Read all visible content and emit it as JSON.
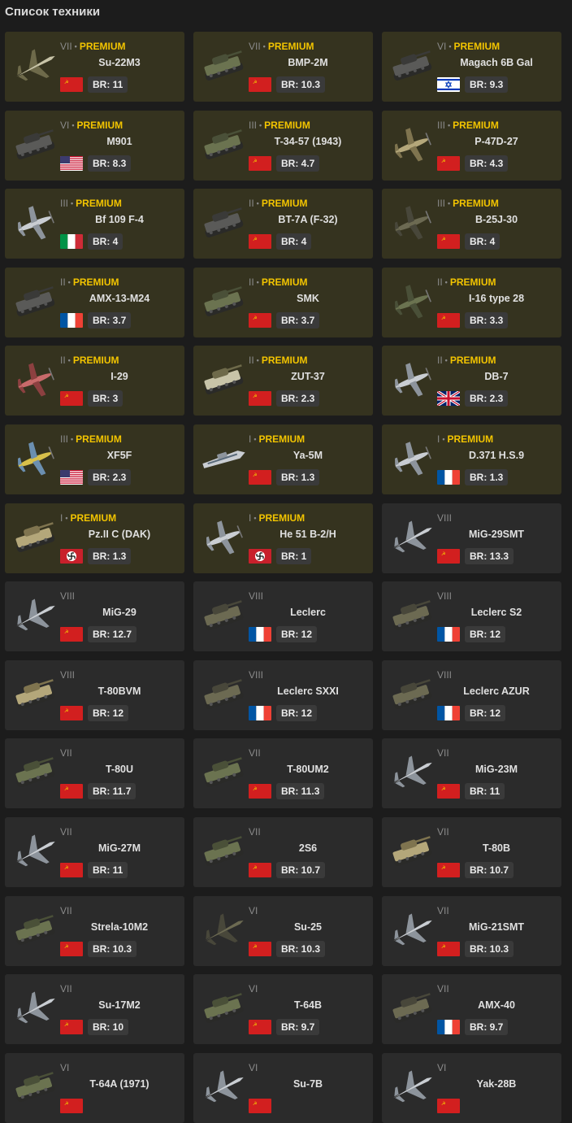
{
  "title": "Список техники",
  "premium_label": "PREMIUM",
  "br_prefix": "BR: ",
  "vehicles": [
    {
      "rank": "VII",
      "premium": true,
      "name": "Su-22M3",
      "nation": "ussr",
      "br": "11",
      "type": "jet",
      "tint": "camo"
    },
    {
      "rank": "VII",
      "premium": true,
      "name": "BMP-2M",
      "nation": "ussr",
      "br": "10.3",
      "type": "tank",
      "tint": "green"
    },
    {
      "rank": "VI",
      "premium": true,
      "name": "Magach 6B Gal",
      "nation": "israel",
      "br": "9.3",
      "type": "tank",
      "tint": "dark"
    },
    {
      "rank": "VI",
      "premium": true,
      "name": "M901",
      "nation": "usa",
      "br": "8.3",
      "type": "tank",
      "tint": "dark"
    },
    {
      "rank": "III",
      "premium": true,
      "name": "T-34-57 (1943)",
      "nation": "ussr",
      "br": "4.7",
      "type": "tank",
      "tint": "green"
    },
    {
      "rank": "III",
      "premium": true,
      "name": "P-47D-27",
      "nation": "ussr",
      "br": "4.3",
      "type": "prop",
      "tint": "tan"
    },
    {
      "rank": "III",
      "premium": true,
      "name": "Bf 109 F-4",
      "nation": "italy",
      "br": "4",
      "type": "prop",
      "tint": "light"
    },
    {
      "rank": "II",
      "premium": true,
      "name": "BT-7A (F-32)",
      "nation": "ussr",
      "br": "4",
      "type": "tank",
      "tint": "dark"
    },
    {
      "rank": "III",
      "premium": true,
      "name": "B-25J-30",
      "nation": "ussr",
      "br": "4",
      "type": "prop",
      "tint": "olive"
    },
    {
      "rank": "II",
      "premium": true,
      "name": "AMX-13-M24",
      "nation": "france",
      "br": "3.7",
      "type": "tank",
      "tint": "dark"
    },
    {
      "rank": "II",
      "premium": true,
      "name": "SMK",
      "nation": "ussr",
      "br": "3.7",
      "type": "tank",
      "tint": "green"
    },
    {
      "rank": "II",
      "premium": true,
      "name": "I-16 type 28",
      "nation": "ussr",
      "br": "3.3",
      "type": "prop",
      "tint": "green"
    },
    {
      "rank": "II",
      "premium": true,
      "name": "I-29",
      "nation": "ussr",
      "br": "3",
      "type": "prop",
      "tint": "red"
    },
    {
      "rank": "II",
      "premium": true,
      "name": "ZUT-37",
      "nation": "ussr",
      "br": "2.3",
      "type": "tank",
      "tint": "camo"
    },
    {
      "rank": "II",
      "premium": true,
      "name": "DB-7",
      "nation": "uk",
      "br": "2.3",
      "type": "prop",
      "tint": "light"
    },
    {
      "rank": "III",
      "premium": true,
      "name": "XF5F",
      "nation": "usa",
      "br": "2.3",
      "type": "prop",
      "tint": "yellow"
    },
    {
      "rank": "I",
      "premium": true,
      "name": "Ya-5M",
      "nation": "ussr",
      "br": "1.3",
      "type": "boat",
      "tint": "light"
    },
    {
      "rank": "I",
      "premium": true,
      "name": "D.371 H.S.9",
      "nation": "france",
      "br": "1.3",
      "type": "prop",
      "tint": "light"
    },
    {
      "rank": "I",
      "premium": true,
      "name": "Pz.II C (DAK)",
      "nation": "germany",
      "br": "1.3",
      "type": "tank",
      "tint": "tan"
    },
    {
      "rank": "I",
      "premium": true,
      "name": "He 51 B-2/H",
      "nation": "germany",
      "br": "1",
      "type": "prop",
      "tint": "light"
    },
    {
      "rank": "VIII",
      "premium": false,
      "name": "MiG-29SMT",
      "nation": "ussr",
      "br": "13.3",
      "type": "jet",
      "tint": "light"
    },
    {
      "rank": "VIII",
      "premium": false,
      "name": "MiG-29",
      "nation": "ussr",
      "br": "12.7",
      "type": "jet",
      "tint": "light"
    },
    {
      "rank": "VIII",
      "premium": false,
      "name": "Leclerc",
      "nation": "france",
      "br": "12",
      "type": "tank",
      "tint": "olive"
    },
    {
      "rank": "VIII",
      "premium": false,
      "name": "Leclerc S2",
      "nation": "france",
      "br": "12",
      "type": "tank",
      "tint": "olive"
    },
    {
      "rank": "VIII",
      "premium": false,
      "name": "T-80BVM",
      "nation": "ussr",
      "br": "12",
      "type": "tank",
      "tint": "tan"
    },
    {
      "rank": "VIII",
      "premium": false,
      "name": "Leclerc SXXI",
      "nation": "france",
      "br": "12",
      "type": "tank",
      "tint": "olive"
    },
    {
      "rank": "VIII",
      "premium": false,
      "name": "Leclerc AZUR",
      "nation": "france",
      "br": "12",
      "type": "tank",
      "tint": "olive"
    },
    {
      "rank": "VII",
      "premium": false,
      "name": "T-80U",
      "nation": "ussr",
      "br": "11.7",
      "type": "tank",
      "tint": "green"
    },
    {
      "rank": "VII",
      "premium": false,
      "name": "T-80UM2",
      "nation": "ussr",
      "br": "11.3",
      "type": "tank",
      "tint": "green"
    },
    {
      "rank": "VII",
      "premium": false,
      "name": "MiG-23M",
      "nation": "ussr",
      "br": "11",
      "type": "jet",
      "tint": "light"
    },
    {
      "rank": "VII",
      "premium": false,
      "name": "MiG-27M",
      "nation": "ussr",
      "br": "11",
      "type": "jet",
      "tint": "light"
    },
    {
      "rank": "VII",
      "premium": false,
      "name": "2S6",
      "nation": "ussr",
      "br": "10.7",
      "type": "tank",
      "tint": "green"
    },
    {
      "rank": "VII",
      "premium": false,
      "name": "T-80B",
      "nation": "ussr",
      "br": "10.7",
      "type": "tank",
      "tint": "tan"
    },
    {
      "rank": "VII",
      "premium": false,
      "name": "Strela-10M2",
      "nation": "ussr",
      "br": "10.3",
      "type": "tank",
      "tint": "green"
    },
    {
      "rank": "VI",
      "premium": false,
      "name": "Su-25",
      "nation": "ussr",
      "br": "10.3",
      "type": "jet",
      "tint": "olive"
    },
    {
      "rank": "VII",
      "premium": false,
      "name": "MiG-21SMT",
      "nation": "ussr",
      "br": "10.3",
      "type": "jet",
      "tint": "light"
    },
    {
      "rank": "VII",
      "premium": false,
      "name": "Su-17M2",
      "nation": "ussr",
      "br": "10",
      "type": "jet",
      "tint": "light"
    },
    {
      "rank": "VI",
      "premium": false,
      "name": "T-64B",
      "nation": "ussr",
      "br": "9.7",
      "type": "tank",
      "tint": "green"
    },
    {
      "rank": "VII",
      "premium": false,
      "name": "AMX-40",
      "nation": "france",
      "br": "9.7",
      "type": "tank",
      "tint": "olive"
    },
    {
      "rank": "VI",
      "premium": false,
      "name": "T-64A (1971)",
      "nation": "ussr",
      "br": "",
      "type": "tank",
      "tint": "green"
    },
    {
      "rank": "VI",
      "premium": false,
      "name": "Su-7B",
      "nation": "ussr",
      "br": "",
      "type": "jet",
      "tint": "light"
    },
    {
      "rank": "VI",
      "premium": false,
      "name": "Yak-28B",
      "nation": "ussr",
      "br": "",
      "type": "jet",
      "tint": "light"
    }
  ]
}
